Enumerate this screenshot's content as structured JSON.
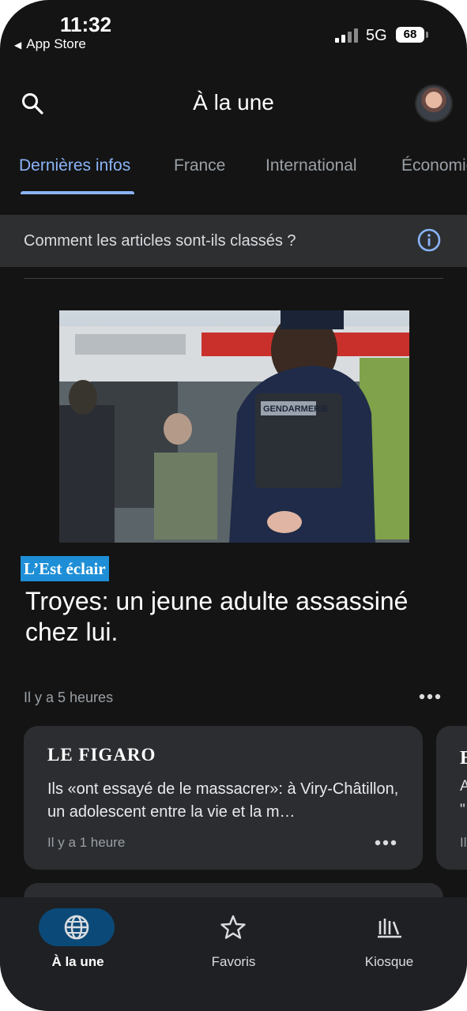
{
  "status_bar": {
    "time": "11:32",
    "back_label": "App Store",
    "network": "5G",
    "battery": "68"
  },
  "header": {
    "title": "À la une",
    "search_icon": "search-icon",
    "avatar_icon": "profile-avatar"
  },
  "tabs": [
    {
      "label": "Dernières infos",
      "active": true
    },
    {
      "label": "France",
      "active": false
    },
    {
      "label": "International",
      "active": false
    },
    {
      "label": "Économie",
      "active": false
    }
  ],
  "info_bar": {
    "text": "Comment les articles sont-ils classés ?",
    "icon": "info-icon"
  },
  "top_story": {
    "source": "L’Est éclair",
    "headline": "Troyes: un jeune adulte assassiné chez lui.",
    "time": "Il y a 5 heures",
    "image_caption": "GENDARMERIE"
  },
  "cards": [
    {
      "source": "LE FIGARO",
      "title": "Ils «ont essayé de le massacrer»: à Viry-Châtillon, un adolescent entre la vie et la m…",
      "time": "Il y a 1 heure"
    },
    {
      "source": "E",
      "title_line1": "A",
      "title_line2": "\"",
      "time": "Il"
    }
  ],
  "bottom_nav": [
    {
      "label": "À la une",
      "icon": "globe-icon",
      "active": true
    },
    {
      "label": "Favoris",
      "icon": "star-icon",
      "active": false
    },
    {
      "label": "Kiosque",
      "icon": "newsstand-icon",
      "active": false
    }
  ],
  "colors": {
    "background": "#141414",
    "accent": "#8ab4f8",
    "source_badge": "#1e8fd6",
    "active_pill": "#0b4a78"
  }
}
